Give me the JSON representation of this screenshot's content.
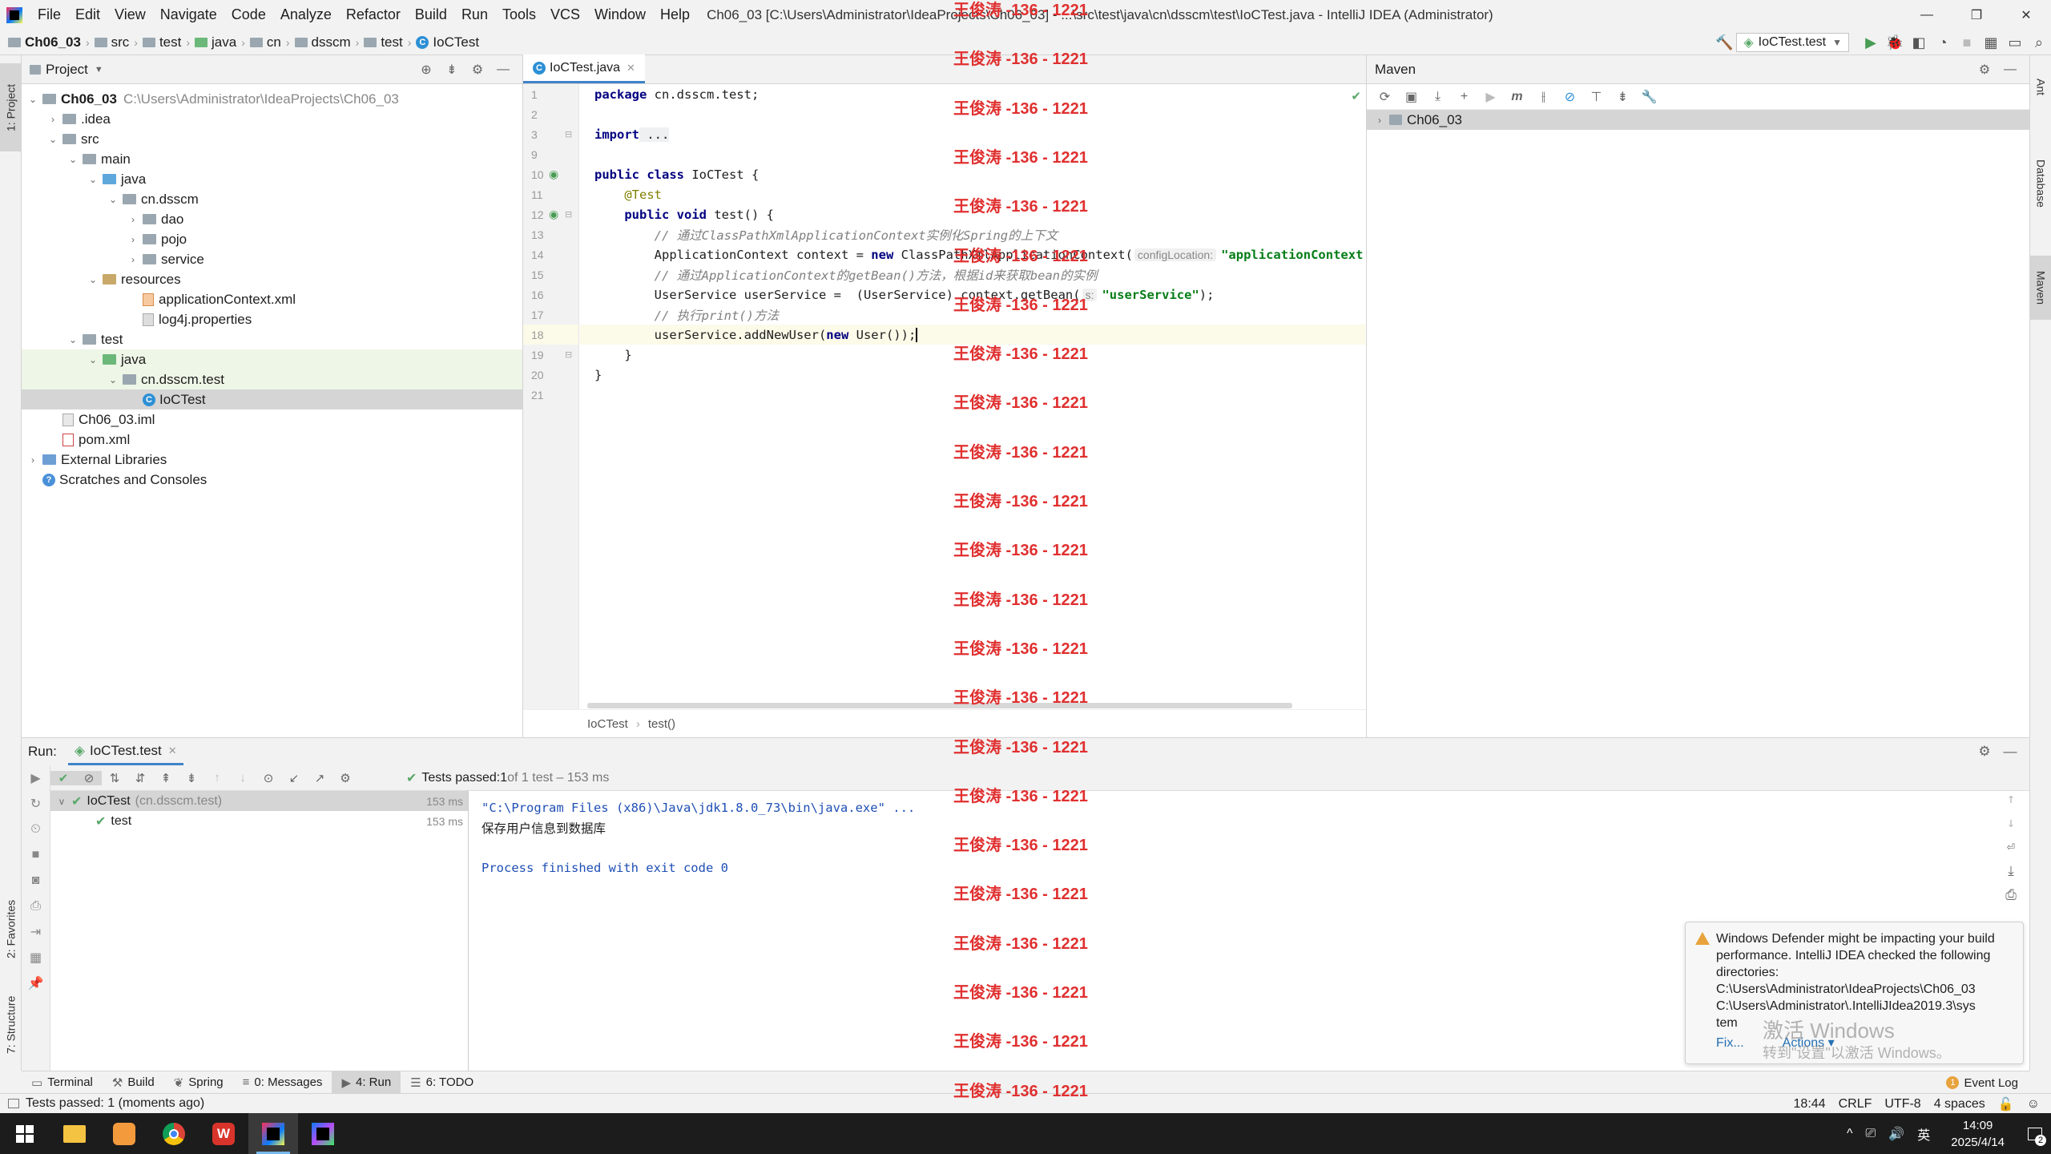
{
  "window": {
    "title": "Ch06_03 [C:\\Users\\Administrator\\IdeaProjects\\Ch06_03] - ...\\src\\test\\java\\cn\\dsscm\\test\\IoCTest.java - IntelliJ IDEA (Administrator)",
    "menu": [
      "File",
      "Edit",
      "View",
      "Navigate",
      "Code",
      "Analyze",
      "Refactor",
      "Build",
      "Run",
      "Tools",
      "VCS",
      "Window",
      "Help"
    ]
  },
  "breadcrumbs": [
    "Ch06_03",
    "src",
    "test",
    "java",
    "cn",
    "dsscm",
    "test",
    "IoCTest"
  ],
  "run_config": "IoCTest.test",
  "project_panel": {
    "title": "Project",
    "tree": [
      {
        "label": "Ch06_03",
        "hint": "C:\\Users\\Administrator\\IdeaProjects\\Ch06_03",
        "depth": 0,
        "arrow": "v",
        "icon": "module",
        "bold": true
      },
      {
        "label": ".idea",
        "depth": 1,
        "arrow": ">",
        "icon": "folder"
      },
      {
        "label": "src",
        "depth": 1,
        "arrow": "v",
        "icon": "folder"
      },
      {
        "label": "main",
        "depth": 2,
        "arrow": "v",
        "icon": "folder"
      },
      {
        "label": "java",
        "depth": 3,
        "arrow": "v",
        "icon": "src"
      },
      {
        "label": "cn.dsscm",
        "depth": 4,
        "arrow": "v",
        "icon": "folder"
      },
      {
        "label": "dao",
        "depth": 5,
        "arrow": ">",
        "icon": "folder"
      },
      {
        "label": "pojo",
        "depth": 5,
        "arrow": ">",
        "icon": "folder"
      },
      {
        "label": "service",
        "depth": 5,
        "arrow": ">",
        "icon": "folder"
      },
      {
        "label": "resources",
        "depth": 3,
        "arrow": "v",
        "icon": "res"
      },
      {
        "label": "applicationContext.xml",
        "depth": 5,
        "arrow": "",
        "icon": "xml"
      },
      {
        "label": "log4j.properties",
        "depth": 5,
        "arrow": "",
        "icon": "prop"
      },
      {
        "label": "test",
        "depth": 2,
        "arrow": "v",
        "icon": "folder"
      },
      {
        "label": "java",
        "depth": 3,
        "arrow": "v",
        "icon": "test",
        "hl": true
      },
      {
        "label": "cn.dsscm.test",
        "depth": 4,
        "arrow": "v",
        "icon": "folder",
        "hl": true
      },
      {
        "label": "IoCTest",
        "depth": 5,
        "arrow": "",
        "icon": "class",
        "sel": true
      },
      {
        "label": "Ch06_03.iml",
        "depth": 1,
        "arrow": "",
        "icon": "iml"
      },
      {
        "label": "pom.xml",
        "depth": 1,
        "arrow": "",
        "icon": "mvn"
      },
      {
        "label": "External Libraries",
        "depth": 0,
        "arrow": ">",
        "icon": "lib"
      },
      {
        "label": "Scratches and Consoles",
        "depth": 0,
        "arrow": "",
        "icon": "scratch"
      }
    ]
  },
  "editor": {
    "tab": "IoCTest.java",
    "lines": [
      "1",
      "2",
      "3",
      "9",
      "10",
      "11",
      "12",
      "13",
      "14",
      "15",
      "16",
      "17",
      "18",
      "19",
      "20",
      "21"
    ],
    "breadcrumb": [
      "IoCTest",
      "test()"
    ],
    "code": {
      "l1a": "package",
      "l1b": " cn.dsscm.test;",
      "l3a": "import",
      "l3b": " ...",
      "l10a": "public class",
      "l10b": " IoCTest {",
      "l11": "@Test",
      "l12a": "public void",
      "l12b": " test() {",
      "l13": "// 通过ClassPathXmlApplicationContext实例化Spring的上下文",
      "l14a": "ApplicationContext context = ",
      "l14b": "new",
      "l14c": " ClassPathXmlApplicationContext(",
      "l14hint": "configLocation:",
      "l14d": "\"applicationContext.xm",
      "l15": "// 通过ApplicationContext的getBean()方法，根据id来获取bean的实例",
      "l16a": "UserService userService =  (UserService) context.getBean(",
      "l16hint": "s:",
      "l16b": "\"userService\"",
      "l16c": ");",
      "l17": "// 执行print()方法",
      "l18a": "userService.addNewUser(",
      "l18b": "new",
      "l18c": " User());",
      "l19": "}",
      "l20": "}"
    }
  },
  "maven": {
    "title": "Maven",
    "project": "Ch06_03"
  },
  "run": {
    "label": "Run:",
    "tab": "IoCTest.test",
    "summary_strong": "Tests passed:",
    "summary_count": " 1",
    "summary_rest": " of 1 test – 153 ms",
    "tree": [
      {
        "label": "IoCTest",
        "hint": "(cn.dsscm.test)",
        "ms": "153 ms"
      },
      {
        "label": "test",
        "ms": "153 ms"
      }
    ],
    "console": [
      "\"C:\\Program Files (x86)\\Java\\jdk1.8.0_73\\bin\\java.exe\" ...",
      "保存用户信息到数据库",
      "",
      "Process finished with exit code 0"
    ]
  },
  "notification": {
    "text": "Windows Defender might be impacting your build performance. IntelliJ IDEA checked the following directories:",
    "dirs": [
      "C:\\Users\\Administrator\\IdeaProjects\\Ch06_03",
      "C:\\Users\\Administrator\\.IntelliJIdea2019.3\\sys",
      "tem"
    ],
    "fix": "Fix...",
    "actions": "Actions ▾"
  },
  "activate_windows": {
    "title": "激活 Windows",
    "sub": "转到\"设置\"以激活 Windows。"
  },
  "bottom_tabs": [
    {
      "label": "Terminal",
      "icon": "▭"
    },
    {
      "label": "Build",
      "icon": "⚒"
    },
    {
      "label": "Spring",
      "icon": "❦"
    },
    {
      "label": "0: Messages",
      "icon": "≡"
    },
    {
      "label": "4: Run",
      "icon": "▶",
      "active": true
    },
    {
      "label": "6: TODO",
      "icon": "☰"
    }
  ],
  "event_log": "Event Log",
  "status": {
    "left": "Tests passed: 1 (moments ago)",
    "position": "18:44",
    "line_sep": "CRLF",
    "encoding": "UTF-8",
    "indent": "4 spaces"
  },
  "left_stripe": {
    "project": "1: Project",
    "favorites": "2: Favorites",
    "structure": "7: Structure"
  },
  "right_stripe": {
    "ant": "Ant",
    "database": "Database",
    "maven": "Maven"
  },
  "watermark": "王俊涛 -136 - 1221",
  "taskbar": {
    "time": "14:09",
    "date": "2025/4/14",
    "ime": "英",
    "notif_count": "2"
  },
  "colors": {
    "accent": "#4083c9",
    "pass": "#59a869",
    "warning": "#e8a33d"
  }
}
